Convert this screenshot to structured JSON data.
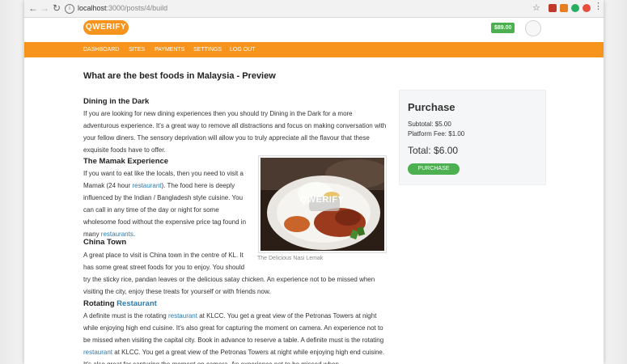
{
  "browser": {
    "url_host": "localhost",
    "url_path": ":3000/posts/4/build"
  },
  "header": {
    "logo": "QWERIFY",
    "balance": "$89.00"
  },
  "nav": [
    "DASHBOARD",
    "SITES",
    "PAYMENTS",
    "SETTINGS",
    "LOG OUT"
  ],
  "page_title": "What are the best foods in Malaysia - Preview",
  "sections": {
    "dining": {
      "heading": "Dining in the Dark",
      "body": "If you are looking for new dining experiences then you should try Dining in the Dark for a more adventurous experience. It's a great way to remove all distractions and focus on making conversation with your fellow diners. The sensory deprivation will allow you to truly appreciate all the flavour that these exquisite foods have to offer."
    },
    "mamak": {
      "heading": "The Mamak Experience",
      "body_a": "If you want to eat like the locals, then you need to visit a Mamak (24 hour ",
      "link_a": "restaurant",
      "body_b": "). The food here is deeply influenced by the Indian / Bangladesh style cuisine. You can call in any time of the day or night for some wholesome food without the expensive price tag found in many ",
      "link_b": "restaurants",
      "body_c": "."
    },
    "china": {
      "heading": "China Town",
      "body": "A great place to visit is China town in the centre of KL. It has some great street foods for you to enjoy. You should try the sticky rice, pandan leaves or the delicious satay chicken. An experience not to be missed when visiting the city, enjoy these treats for yourself or with friends now."
    },
    "rotating": {
      "heading_a": "Rotating ",
      "heading_link": "Restaurant",
      "body_a": "A definite must is the rotating ",
      "link_a": "restaurant",
      "body_b": " at KLCC. You get a great view of the Petronas Towers at night while enjoying high end cuisine. It's also great for capturing the moment on camera. An experience not to be missed when visiting the capital city. Book in advance to reserve a table. A definite must is the rotating ",
      "link_b": "restaurant",
      "body_c": " at KLCC. You get a great view of the Petronas Towers at night while enjoying high end cuisine. It's also great for capturing the moment on camera. An experience not to be missed when"
    }
  },
  "figure": {
    "watermark": "QWERIFY",
    "caption": "The Delicious Nasi Lemak"
  },
  "purchase": {
    "title": "Purchase",
    "subtotal": "Subtotal: $5.00",
    "fee": "Platform Fee: $1.00",
    "total": "Total: $6.00",
    "button": "PURCHASE"
  },
  "colors": {
    "brand_orange": "#f7941d",
    "success_green": "#4caf50",
    "link_blue": "#2a7ab0"
  }
}
